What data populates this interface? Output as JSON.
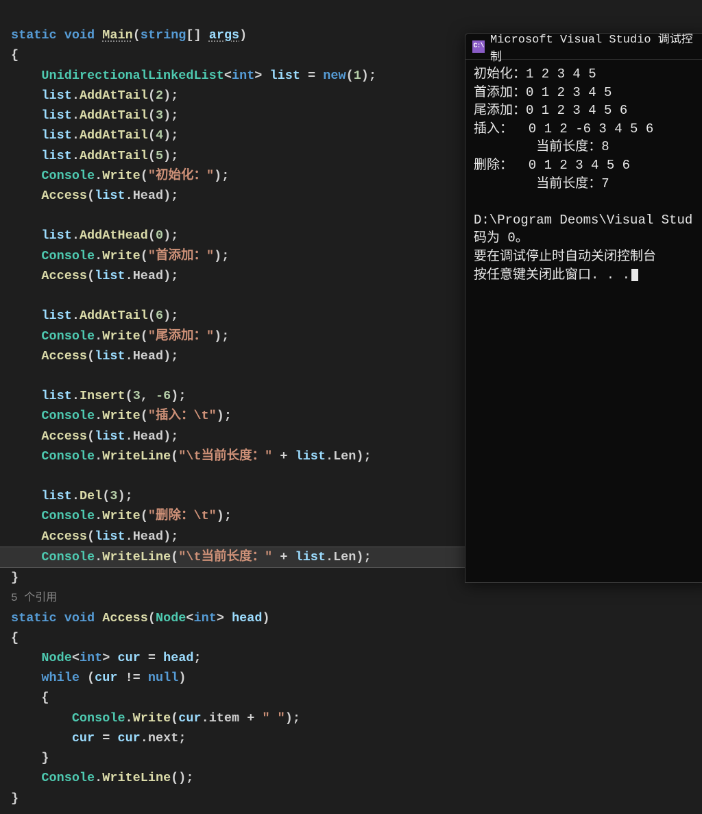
{
  "code": {
    "main_sig": {
      "kw_static": "static",
      "kw_void": "void",
      "name": "Main",
      "kw_string": "string",
      "param": "args"
    },
    "line_listdecl": {
      "typ": "UnidirectionalLinkedList",
      "generic": "int",
      "var": "list",
      "kw_new": "new",
      "arg": "1"
    },
    "addtail2": {
      "obj": "list",
      "mth": "AddAtTail",
      "arg": "2"
    },
    "addtail3": {
      "obj": "list",
      "mth": "AddAtTail",
      "arg": "3"
    },
    "addtail4": {
      "obj": "list",
      "mth": "AddAtTail",
      "arg": "4"
    },
    "addtail5": {
      "obj": "list",
      "mth": "AddAtTail",
      "arg": "5"
    },
    "cw_init": {
      "cls": "Console",
      "mth": "Write",
      "str": "\"初始化：\""
    },
    "access1": {
      "mth": "Access",
      "obj": "list",
      "prop": "Head"
    },
    "addhead0": {
      "obj": "list",
      "mth": "AddAtHead",
      "arg": "0"
    },
    "cw_head": {
      "cls": "Console",
      "mth": "Write",
      "str": "\"首添加：\""
    },
    "access2": {
      "mth": "Access",
      "obj": "list",
      "prop": "Head"
    },
    "addtail6": {
      "obj": "list",
      "mth": "AddAtTail",
      "arg": "6"
    },
    "cw_tail": {
      "cls": "Console",
      "mth": "Write",
      "str": "\"尾添加：\""
    },
    "access3": {
      "mth": "Access",
      "obj": "list",
      "prop": "Head"
    },
    "insert": {
      "obj": "list",
      "mth": "Insert",
      "arg1": "3",
      "arg2": "-6"
    },
    "cw_insert": {
      "cls": "Console",
      "mth": "Write",
      "str": "\"插入：\\t\""
    },
    "access4": {
      "mth": "Access",
      "obj": "list",
      "prop": "Head"
    },
    "cwl_len1": {
      "cls": "Console",
      "mth": "WriteLine",
      "str": "\"\\t当前长度：\"",
      "obj": "list",
      "prop": "Len"
    },
    "del": {
      "obj": "list",
      "mth": "Del",
      "arg": "3"
    },
    "cw_del": {
      "cls": "Console",
      "mth": "Write",
      "str": "\"删除：\\t\""
    },
    "access5": {
      "mth": "Access",
      "obj": "list",
      "prop": "Head"
    },
    "cwl_len2": {
      "cls": "Console",
      "mth": "WriteLine",
      "str": "\"\\t当前长度：\"",
      "obj": "list",
      "prop": "Len"
    },
    "codelens": "5 个引用",
    "access_sig": {
      "kw_static": "static",
      "kw_void": "void",
      "name": "Access",
      "typ": "Node",
      "generic": "int",
      "param": "head"
    },
    "node_decl": {
      "typ": "Node",
      "generic": "int",
      "var": "cur",
      "param": "head"
    },
    "while": {
      "kw": "while",
      "var": "cur",
      "kw_null": "null"
    },
    "cw_item": {
      "cls": "Console",
      "mth": "Write",
      "var": "cur",
      "prop": "item",
      "str": "\" \""
    },
    "cur_next": {
      "var": "cur",
      "prop": "next"
    },
    "cwl_empty": {
      "cls": "Console",
      "mth": "WriteLine"
    }
  },
  "console": {
    "title": "Microsoft Visual Studio 调试控制",
    "lines": [
      "初始化：1 2 3 4 5",
      "首添加：0 1 2 3 4 5",
      "尾添加：0 1 2 3 4 5 6",
      "插入：  0 1 2 -6 3 4 5 6",
      "        当前长度：8",
      "删除：  0 1 2 3 4 5 6",
      "        当前长度：7",
      "",
      "D:\\Program Deoms\\Visual Stud",
      "码为 0。",
      "要在调试停止时自动关闭控制台",
      "按任意键关闭此窗口. . ."
    ]
  }
}
